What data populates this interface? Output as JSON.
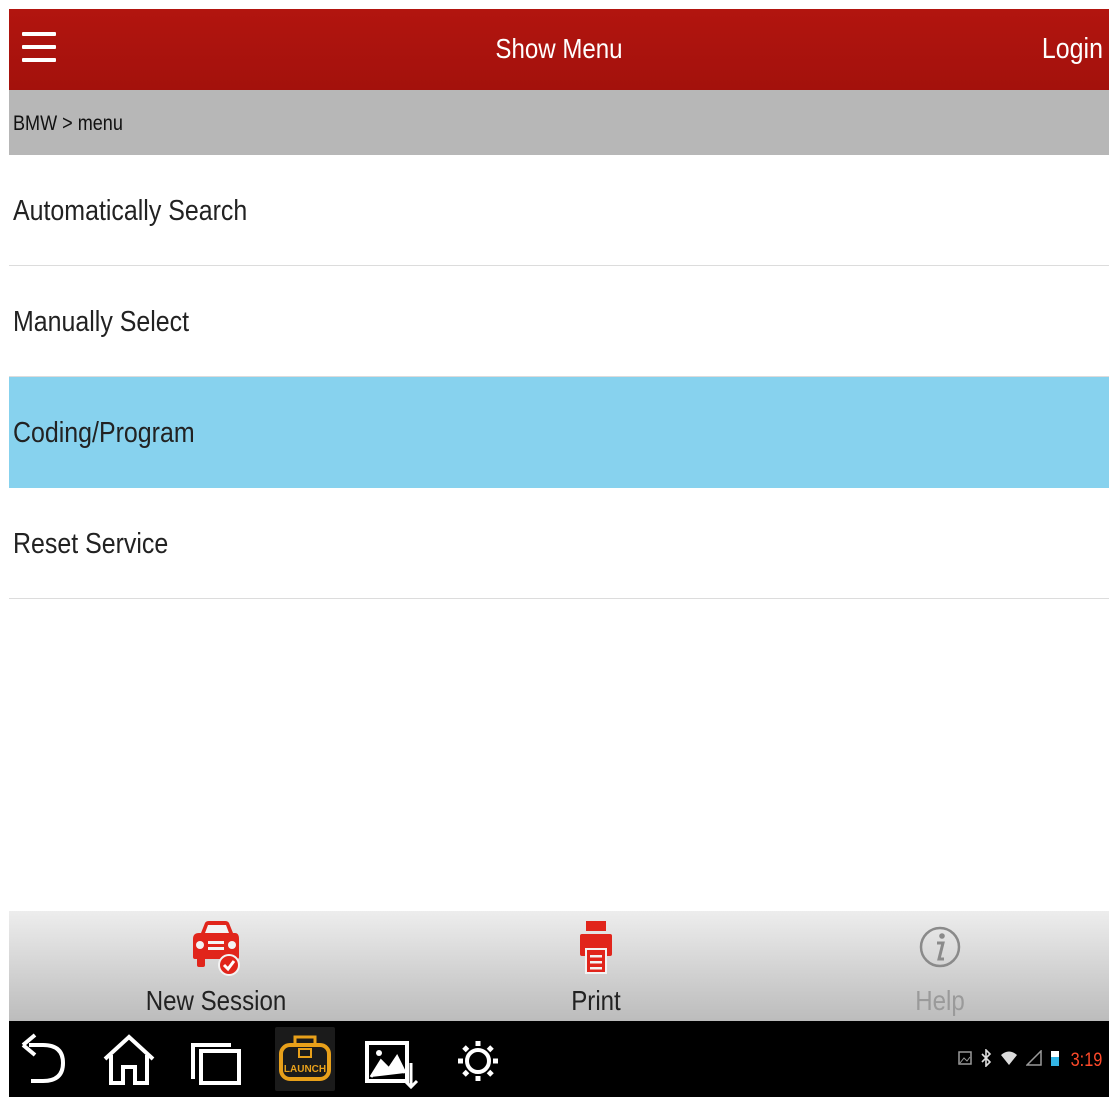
{
  "app_bar": {
    "title": "Show Menu",
    "login_label": "Login",
    "color": "#a8120d"
  },
  "breadcrumb": {
    "text": "BMW > menu"
  },
  "menu": {
    "items": [
      {
        "label": "Automatically Search"
      },
      {
        "label": "Manually Select"
      },
      {
        "label": "Coding/Program"
      },
      {
        "label": "Reset Service"
      }
    ],
    "selected": "Coding/Program",
    "selected_color": "#87d2ee"
  },
  "toolbar": {
    "new_session_label": "New Session",
    "print_label": "Print",
    "help_label": "Help",
    "icons": [
      "car-icon",
      "printer-icon",
      "info-icon"
    ],
    "accent_color": "#e1251b"
  },
  "nav_bar": {
    "launch_label": "LAUNCH",
    "icons": [
      "back-icon",
      "home-icon",
      "recent-apps-icon",
      "launch-icon",
      "screenshot-icon",
      "settings-icon"
    ]
  },
  "status_bar": {
    "clock": "3:19",
    "icons": [
      "gallery-notification-icon",
      "bluetooth-icon",
      "wifi-icon",
      "signal-icon",
      "battery-icon"
    ]
  }
}
